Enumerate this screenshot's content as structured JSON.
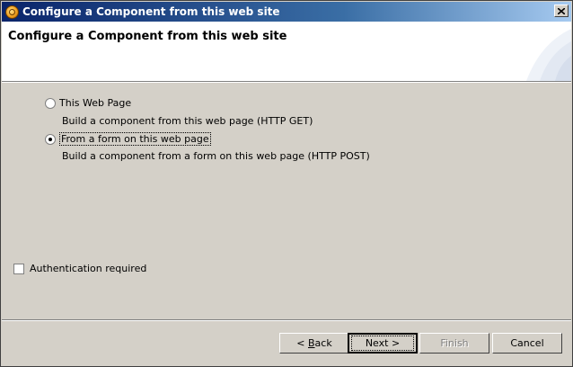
{
  "window": {
    "title": "Configure a Component from this web site"
  },
  "header": {
    "title": "Configure a Component from this web site"
  },
  "options": [
    {
      "label": "This Web Page",
      "description": "Build a component from this web page (HTTP GET)",
      "selected": false
    },
    {
      "label": "From a form on this web page",
      "description": "Build a component from a form on this web page (HTTP POST)",
      "selected": true
    }
  ],
  "auth": {
    "label": "Authentication required",
    "checked": false
  },
  "buttons": {
    "back_prefix": "< ",
    "back_mnemonic": "B",
    "back_rest": "ack",
    "next": "Next >",
    "finish": "Finish",
    "cancel": "Cancel"
  },
  "colors": {
    "face": "#d4d0c8",
    "title_start": "#0a246a",
    "title_end": "#a6caf0"
  },
  "icons": [
    "app-icon",
    "close-icon",
    "radio-icon",
    "checkbox-icon"
  ]
}
